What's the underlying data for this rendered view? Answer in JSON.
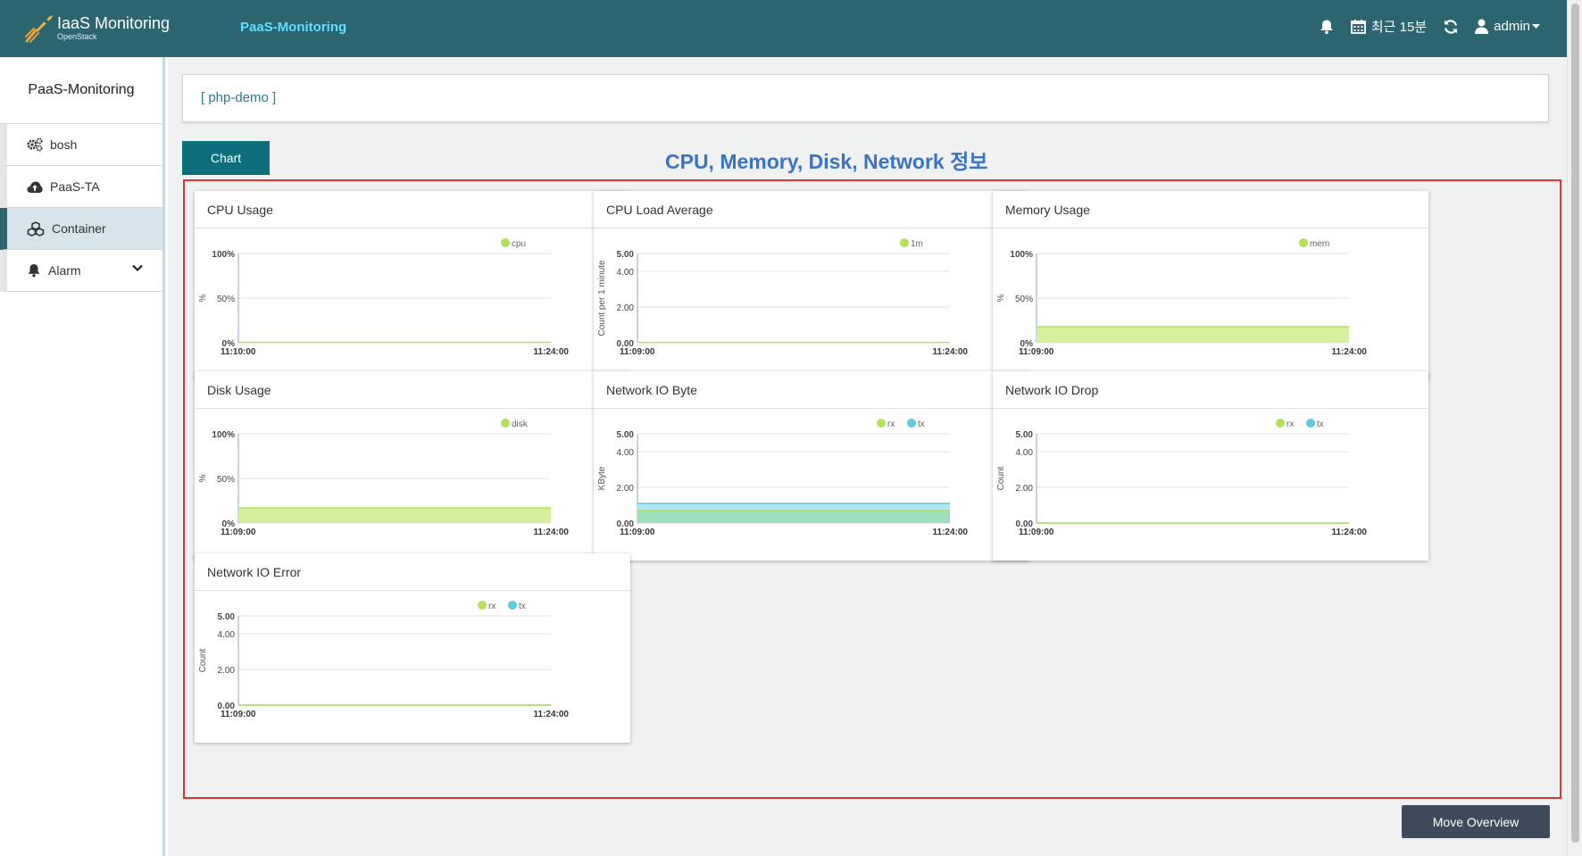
{
  "header": {
    "brand_title": "IaaS Monitoring",
    "brand_sub": "OpenStack",
    "nav_label": "PaaS-Monitoring",
    "time_range": "최근 15분",
    "user": "admin"
  },
  "sidebar": {
    "title": "PaaS-Monitoring",
    "items": [
      {
        "label": "bosh",
        "icon": "gears-icon"
      },
      {
        "label": "PaaS-TA",
        "icon": "cloud-upload-icon"
      },
      {
        "label": "Container",
        "icon": "cubes-icon",
        "active": true
      },
      {
        "label": "Alarm",
        "icon": "bell-icon",
        "expandable": true
      }
    ]
  },
  "main": {
    "app_name": "[ php-demo ]",
    "chart_tab": "Chart",
    "section_title": "CPU, Memory, Disk, Network 정보",
    "move_button": "Move Overview"
  },
  "colors": {
    "header_bg": "#2c6470",
    "accent": "#0f6e7c",
    "series_green": "#b5e05a",
    "series_blue": "#5ccbe0",
    "frame_red": "#e03333"
  },
  "chart_data": [
    {
      "title": "CPU Usage",
      "type": "area",
      "ylabel": "%",
      "ylim": [
        0,
        100
      ],
      "yticks": [
        "0%",
        "50%",
        "100%"
      ],
      "xticks": [
        "11:10:00",
        "11:24:00"
      ],
      "series": [
        {
          "name": "cpu",
          "color": "#b5e05a",
          "values": [
            0.5,
            0.5
          ]
        }
      ]
    },
    {
      "title": "CPU Load Average",
      "type": "line",
      "ylabel": "Count per 1 minute",
      "ylim": [
        0,
        5
      ],
      "yticks": [
        "0.00",
        "2.00",
        "4.00",
        "5.00"
      ],
      "xticks": [
        "11:09:00",
        "11:24:00"
      ],
      "series": [
        {
          "name": "1m",
          "color": "#b5e05a",
          "values": [
            0.02,
            0.02
          ]
        }
      ]
    },
    {
      "title": "Memory Usage",
      "type": "area",
      "ylabel": "%",
      "ylim": [
        0,
        100
      ],
      "yticks": [
        "0%",
        "50%",
        "100%"
      ],
      "xticks": [
        "11:09:00",
        "11:24:00"
      ],
      "series": [
        {
          "name": "mem",
          "color": "#b5e05a",
          "values": [
            18,
            18
          ]
        }
      ]
    },
    {
      "title": "Disk Usage",
      "type": "area",
      "ylabel": "%",
      "ylim": [
        0,
        100
      ],
      "yticks": [
        "0%",
        "50%",
        "100%"
      ],
      "xticks": [
        "11:09:00",
        "11:24:00"
      ],
      "series": [
        {
          "name": "disk",
          "color": "#b5e05a",
          "values": [
            17,
            17
          ]
        }
      ]
    },
    {
      "title": "Network IO Byte",
      "type": "area",
      "ylabel": "KByte",
      "ylim": [
        0,
        5
      ],
      "yticks": [
        "0.00",
        "2.00",
        "4.00",
        "5.00"
      ],
      "xticks": [
        "11:09:00",
        "11:24:00"
      ],
      "series": [
        {
          "name": "rx",
          "color": "#b5e05a",
          "values": [
            0.7,
            0.7
          ]
        },
        {
          "name": "tx",
          "color": "#5ccbe0",
          "values": [
            1.1,
            1.1
          ]
        }
      ]
    },
    {
      "title": "Network IO Drop",
      "type": "line",
      "ylabel": "Count",
      "ylim": [
        0,
        5
      ],
      "yticks": [
        "0.00",
        "2.00",
        "4.00",
        "5.00"
      ],
      "xticks": [
        "11:09:00",
        "11:24:00"
      ],
      "series": [
        {
          "name": "rx",
          "color": "#b5e05a",
          "values": [
            0,
            0
          ]
        },
        {
          "name": "tx",
          "color": "#5ccbe0",
          "values": [
            0,
            0
          ]
        }
      ]
    },
    {
      "title": "Network IO Error",
      "type": "line",
      "ylabel": "Count",
      "ylim": [
        0,
        5
      ],
      "yticks": [
        "0.00",
        "2.00",
        "4.00",
        "5.00"
      ],
      "xticks": [
        "11:09:00",
        "11:24:00"
      ],
      "series": [
        {
          "name": "rx",
          "color": "#b5e05a",
          "values": [
            0,
            0
          ]
        },
        {
          "name": "tx",
          "color": "#5ccbe0",
          "values": [
            0,
            0
          ]
        }
      ]
    }
  ]
}
